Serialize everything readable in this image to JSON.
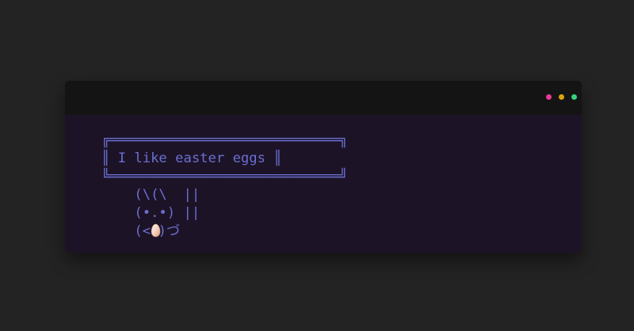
{
  "window": {
    "controls": [
      {
        "name": "close",
        "color": "#e83a94"
      },
      {
        "name": "minimize",
        "color": "#d7a50e"
      },
      {
        "name": "zoom",
        "color": "#34d27d"
      }
    ]
  },
  "terminal": {
    "box_top": "╔════════════════════════════╗",
    "box_middle": "║ I like easter eggs ║",
    "box_bottom": "╚════════════════════════════╝",
    "bunny_line_1": "    (\\(\\  ||",
    "bunny_line_2": "    (•.•) ||",
    "bunny_line_3_prefix": "    (<",
    "bunny_line_3_suffix": ")づ",
    "egg_icon": "egg-icon"
  }
}
